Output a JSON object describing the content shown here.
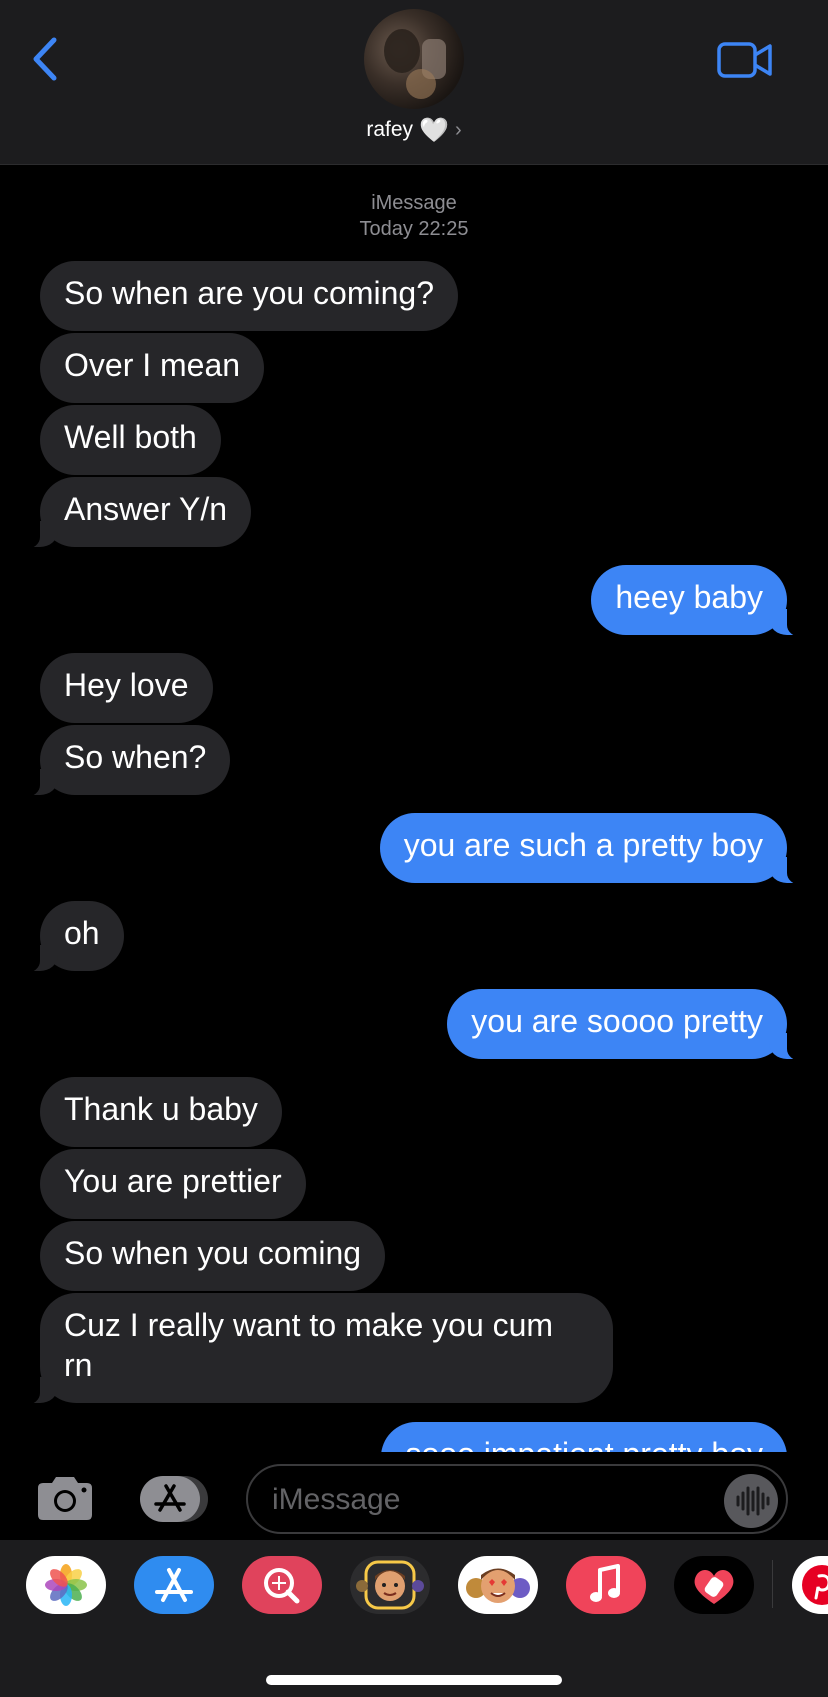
{
  "header": {
    "contact_name": "rafey",
    "contact_heart": "🤍",
    "chevron": "›"
  },
  "conversation": {
    "service": "iMessage",
    "timestamp": "Today 22:25",
    "messages": [
      {
        "from": "them",
        "text": "So when are you coming?"
      },
      {
        "from": "them",
        "text": "Over I mean"
      },
      {
        "from": "them",
        "text": "Well both"
      },
      {
        "from": "them",
        "text": "Answer Y/n"
      },
      {
        "from": "me",
        "text": "heey baby"
      },
      {
        "from": "them",
        "text": "Hey love"
      },
      {
        "from": "them",
        "text": "So when?"
      },
      {
        "from": "me",
        "text": "you are such a pretty boy"
      },
      {
        "from": "them",
        "text": "oh"
      },
      {
        "from": "me",
        "text": "you are soooo pretty"
      },
      {
        "from": "them",
        "text": "Thank u baby"
      },
      {
        "from": "them",
        "text": "You are prettier"
      },
      {
        "from": "them",
        "text": "So when you coming"
      },
      {
        "from": "them",
        "text": "Cuz I really want to make you cum rn"
      },
      {
        "from": "me",
        "text": "sooo impatient pretty boy"
      }
    ]
  },
  "composer": {
    "placeholder": "iMessage",
    "value": ""
  },
  "app_drawer": {
    "apps": [
      "photos-icon",
      "app-store-icon",
      "image-search-icon",
      "memoji-stickers-icon",
      "animoji-icon",
      "music-icon",
      "digital-touch-icon",
      "pinterest-icon"
    ]
  },
  "colors": {
    "sent_bubble": "#3d85f5",
    "received_bubble": "#262629",
    "accent": "#3d85f5",
    "background": "#000000",
    "header_bg": "#1c1c1e"
  }
}
